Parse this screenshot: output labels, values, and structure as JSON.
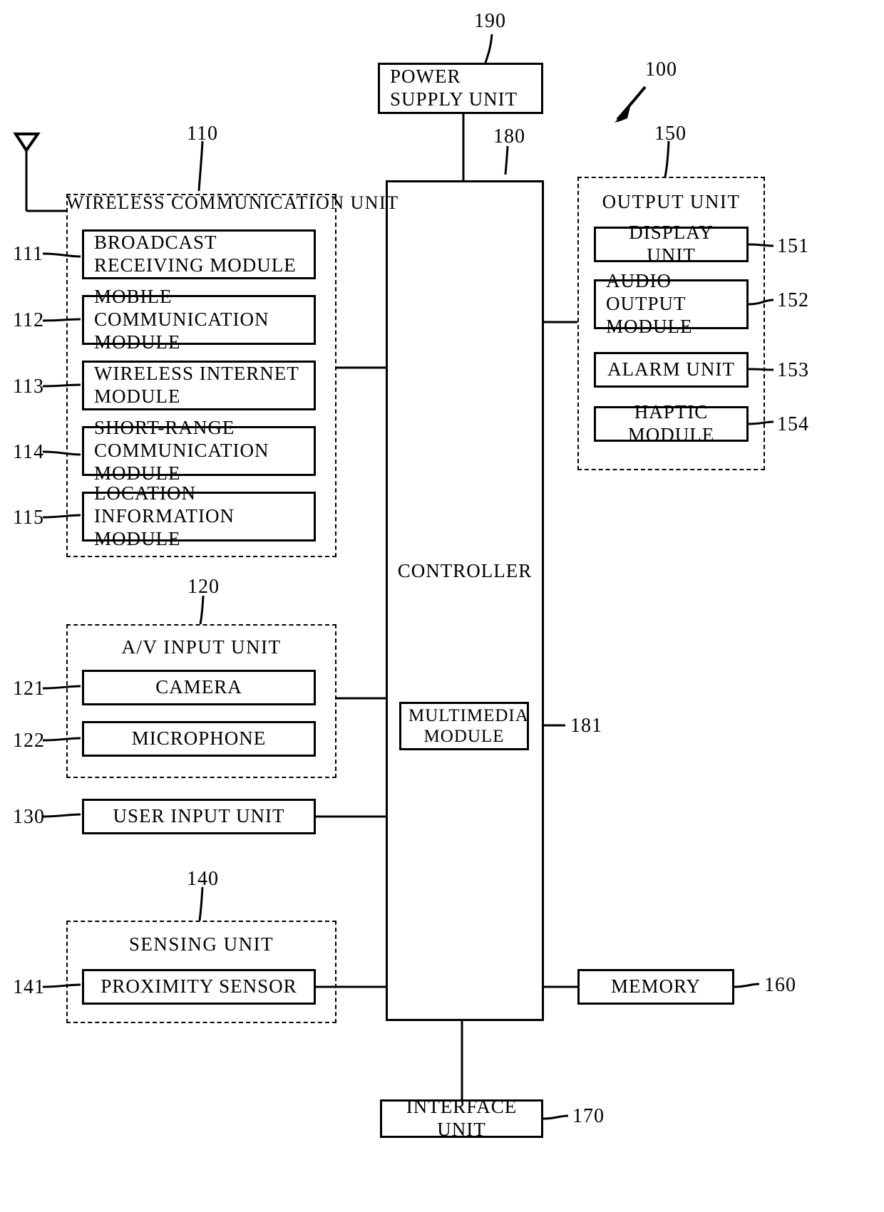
{
  "figure": {
    "device_ref": "100",
    "antenna_icon": "antenna-icon"
  },
  "power_supply": {
    "label": "POWER SUPPLY UNIT",
    "ref": "190"
  },
  "controller": {
    "label": "CONTROLLER",
    "ref": "180",
    "multimedia": {
      "label": "MULTIMEDIA MODULE",
      "ref": "181"
    }
  },
  "wireless_communication_unit": {
    "title": "WIRELESS COMMUNICATION UNIT",
    "ref": "110",
    "modules": [
      {
        "label": "BROADCAST RECEIVING MODULE",
        "ref": "111"
      },
      {
        "label": "MOBILE COMMUNICATION MODULE",
        "ref": "112"
      },
      {
        "label": "WIRELESS INTERNET MODULE",
        "ref": "113"
      },
      {
        "label": "SHORT-RANGE COMMUNICATION MODULE",
        "ref": "114"
      },
      {
        "label": "LOCATION INFORMATION MODULE",
        "ref": "115"
      }
    ]
  },
  "av_input_unit": {
    "title": "A/V INPUT UNIT",
    "ref": "120",
    "modules": [
      {
        "label": "CAMERA",
        "ref": "121"
      },
      {
        "label": "MICROPHONE",
        "ref": "122"
      }
    ]
  },
  "user_input_unit": {
    "label": "USER INPUT UNIT",
    "ref": "130"
  },
  "sensing_unit": {
    "title": "SENSING UNIT",
    "ref": "140",
    "modules": [
      {
        "label": "PROXIMITY SENSOR",
        "ref": "141"
      }
    ]
  },
  "output_unit": {
    "title": "OUTPUT UNIT",
    "ref": "150",
    "modules": [
      {
        "label": "DISPLAY UNIT",
        "ref": "151"
      },
      {
        "label": "AUDIO OUTPUT MODULE",
        "ref": "152"
      },
      {
        "label": "ALARM UNIT",
        "ref": "153"
      },
      {
        "label": "HAPTIC MODULE",
        "ref": "154"
      }
    ]
  },
  "memory": {
    "label": "MEMORY",
    "ref": "160"
  },
  "interface_unit": {
    "label": "INTERFACE UNIT",
    "ref": "170"
  }
}
